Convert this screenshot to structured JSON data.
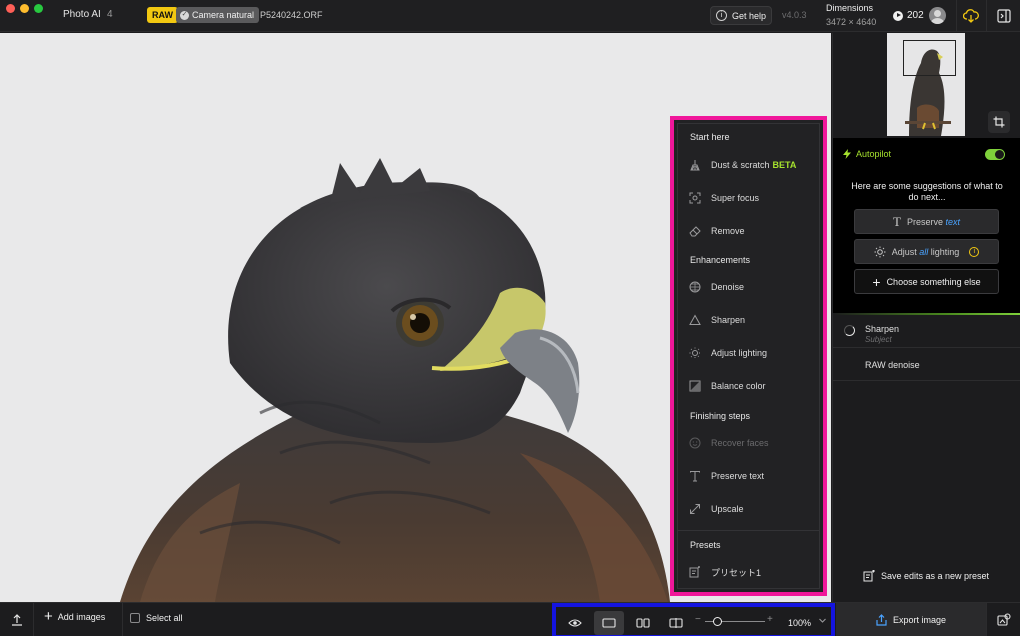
{
  "app": {
    "name": "Photo AI",
    "version_major": "4",
    "version": "v4.0.3"
  },
  "header": {
    "badge_raw": "RAW",
    "badge_camera": "Camera natural",
    "filename": "P5240242.ORF",
    "help_label": "Get help",
    "dimensions_label": "Dimensions",
    "dimensions_value": "3472 × 4640",
    "credits": "202"
  },
  "tools_menu": {
    "sections": [
      {
        "title": "Start here",
        "items": [
          {
            "label": "Dust & scratch",
            "tag": "BETA",
            "icon": "broom-icon",
            "enabled": true
          },
          {
            "label": "Super focus",
            "icon": "focus-icon",
            "enabled": true
          },
          {
            "label": "Remove",
            "icon": "eraser-icon",
            "enabled": true
          }
        ]
      },
      {
        "title": "Enhancements",
        "items": [
          {
            "label": "Denoise",
            "icon": "grain-icon",
            "enabled": true
          },
          {
            "label": "Sharpen",
            "icon": "triangle-icon",
            "enabled": true
          },
          {
            "label": "Adjust lighting",
            "icon": "light-icon",
            "enabled": true
          },
          {
            "label": "Balance color",
            "icon": "color-balance-icon",
            "enabled": true
          }
        ]
      },
      {
        "title": "Finishing steps",
        "items": [
          {
            "label": "Recover faces",
            "icon": "face-icon",
            "enabled": false
          },
          {
            "label": "Preserve text",
            "icon": "text-icon",
            "enabled": true
          },
          {
            "label": "Upscale",
            "icon": "upscale-icon",
            "enabled": true
          }
        ]
      },
      {
        "title": "Presets",
        "items": [
          {
            "label": "プリセット1",
            "icon": "preset-icon",
            "enabled": true
          }
        ]
      }
    ]
  },
  "autopilot": {
    "title": "Autopilot",
    "enabled": true,
    "suggestion": "Here are some suggestions of what to do next...",
    "preserve_prefix": "Preserve",
    "preserve_accent": "text",
    "adjust_prefix": "Adjust",
    "adjust_accent": "all",
    "adjust_suffix": "lighting",
    "choose_label": "Choose something else"
  },
  "queue": [
    {
      "title": "Sharpen",
      "subtitle": "Subject"
    },
    {
      "title": "RAW denoise",
      "subtitle": ""
    }
  ],
  "save_preset_label": "Save edits as a new preset",
  "bottom": {
    "add_images": "Add images",
    "select_all": "Select all",
    "zoom_value": "100%",
    "zoom_fraction": 0.2,
    "export_label": "Export image"
  },
  "colors": {
    "accent_green": "#a6e22e",
    "toggle_green": "#7fd13b",
    "menu_highlight": "#f0179a",
    "view_highlight": "#1414e0",
    "raw_badge": "#f2c811"
  }
}
